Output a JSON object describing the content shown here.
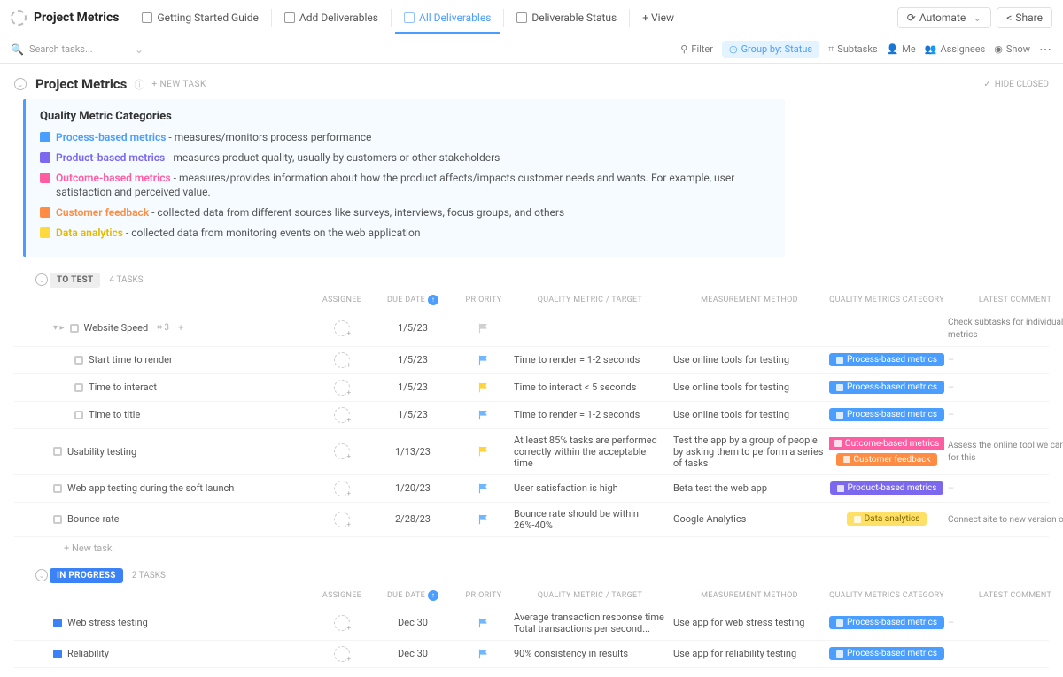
{
  "header": {
    "project": "Project Metrics",
    "tabs": [
      "Getting Started Guide",
      "Add Deliverables",
      "All Deliverables",
      "Deliverable Status"
    ],
    "addView": "+ View",
    "automate": "Automate",
    "share": "Share"
  },
  "toolbar": {
    "searchPlaceholder": "Search tasks...",
    "filter": "Filter",
    "groupBy": "Group by: Status",
    "subtasks": "Subtasks",
    "me": "Me",
    "assignees": "Assignees",
    "show": "Show"
  },
  "section": {
    "title": "Project Metrics",
    "newTask": "+ NEW TASK",
    "hideClosed": "HIDE CLOSED"
  },
  "notebox": {
    "heading": "Quality Metric Categories",
    "rows": [
      {
        "color": "c-blue",
        "tcolor": "t-blue",
        "name": "Process-based metrics",
        "desc": " - measures/monitors process performance"
      },
      {
        "color": "c-purple",
        "tcolor": "t-purple",
        "name": "Product-based metrics",
        "desc": " - measures product quality, usually by  customers or other stakeholders"
      },
      {
        "color": "c-pink",
        "tcolor": "t-pink",
        "name": "Outcome-based metrics",
        "desc": " - measures/provides information about how the product affects/impacts customer needs and wants. For example, user satisfaction and perceived value."
      },
      {
        "color": "c-orange",
        "tcolor": "t-orange",
        "name": "Customer feedback",
        "desc": " - collected data from different sources like surveys, interviews, focus groups, and others"
      },
      {
        "color": "c-yellow",
        "tcolor": "t-yellow",
        "name": "Data analytics",
        "desc": " - collected data from monitoring events on the web application"
      }
    ]
  },
  "columns": {
    "assignee": "ASSIGNEE",
    "due": "DUE DATE",
    "priority": "PRIORITY",
    "target": "QUALITY METRIC / TARGET",
    "method": "MEASUREMENT METHOD",
    "category": "QUALITY METRICS CATEGORY",
    "comment": "LATEST COMMENT"
  },
  "groups": [
    {
      "status": "TO TEST",
      "pillClass": "",
      "count": "4 TASKS",
      "rows": [
        {
          "name": "Website Speed",
          "sub": "3",
          "due": "1/5/23",
          "flag": "#d0d0d0",
          "target": "",
          "method": "",
          "badges": [],
          "comment": "Check subtasks for individual metrics",
          "caret": true,
          "plus": true
        },
        {
          "indent": true,
          "name": "Start time to render",
          "due": "1/5/23",
          "flag": "#6fb8ff",
          "target": "Time to render = 1-2 seconds",
          "method": "Use online tools for testing",
          "badges": [
            {
              "cls": "b-blue",
              "txt": "Process-based metrics"
            }
          ],
          "comment": "-"
        },
        {
          "indent": true,
          "name": "Time to interact",
          "due": "1/5/23",
          "flag": "#ffd43b",
          "target": "Time to interact < 5 seconds",
          "method": "Use online tools for testing",
          "badges": [
            {
              "cls": "b-blue",
              "txt": "Process-based metrics"
            }
          ],
          "comment": "-"
        },
        {
          "indent": true,
          "name": "Time to title",
          "due": "1/5/23",
          "flag": "#6fb8ff",
          "target": "Time to render = 1-2 seconds",
          "method": "Use online tools for testing",
          "badges": [
            {
              "cls": "b-blue",
              "txt": "Process-based metrics"
            }
          ],
          "comment": "-"
        },
        {
          "name": "Usability testing",
          "due": "1/13/23",
          "flag": "#ffd43b",
          "target": "At least 85% tasks are performed correctly within the acceptable time",
          "method": "Test the app by a group of people by asking them to perform a series of tasks",
          "badges": [
            {
              "cls": "b-pink",
              "txt": "Outcome-based metrics"
            },
            {
              "cls": "b-orange",
              "txt": "Customer feedback"
            }
          ],
          "comment": "Assess the online tool we can use for this"
        },
        {
          "name": "Web app testing during the soft launch",
          "due": "1/20/23",
          "flag": "#6fb8ff",
          "target": "User satisfaction is high",
          "method": "Beta test the web app",
          "badges": [
            {
              "cls": "b-purple",
              "txt": "Product-based metrics"
            }
          ],
          "comment": "-"
        },
        {
          "name": "Bounce rate",
          "due": "2/28/23",
          "flag": "#6fb8ff",
          "target": "Bounce rate should be within 26%-40%",
          "method": "Google Analytics",
          "badges": [
            {
              "cls": "b-yellow",
              "txt": "Data analytics"
            }
          ],
          "comment": "Connect site to new version of GA"
        }
      ],
      "addRow": "+ New task"
    },
    {
      "status": "IN PROGRESS",
      "pillClass": "prog",
      "count": "2 TASKS",
      "rows": [
        {
          "sqClass": "blue",
          "name": "Web stress testing",
          "due": "Dec 30",
          "flag": "#6fb8ff",
          "target": "Average transaction response time Total transactions per second...",
          "method": "Use app for web stress testing",
          "badges": [
            {
              "cls": "b-blue",
              "txt": "Process-based metrics"
            }
          ],
          "comment": "-"
        },
        {
          "sqClass": "blue",
          "name": "Reliability",
          "due": "Dec 30",
          "flag": "#6fb8ff",
          "target": "90% consistency in results",
          "method": "Use app for reliability testing",
          "badges": [
            {
              "cls": "b-blue",
              "txt": "Process-based metrics"
            }
          ],
          "comment": ""
        }
      ]
    }
  ]
}
